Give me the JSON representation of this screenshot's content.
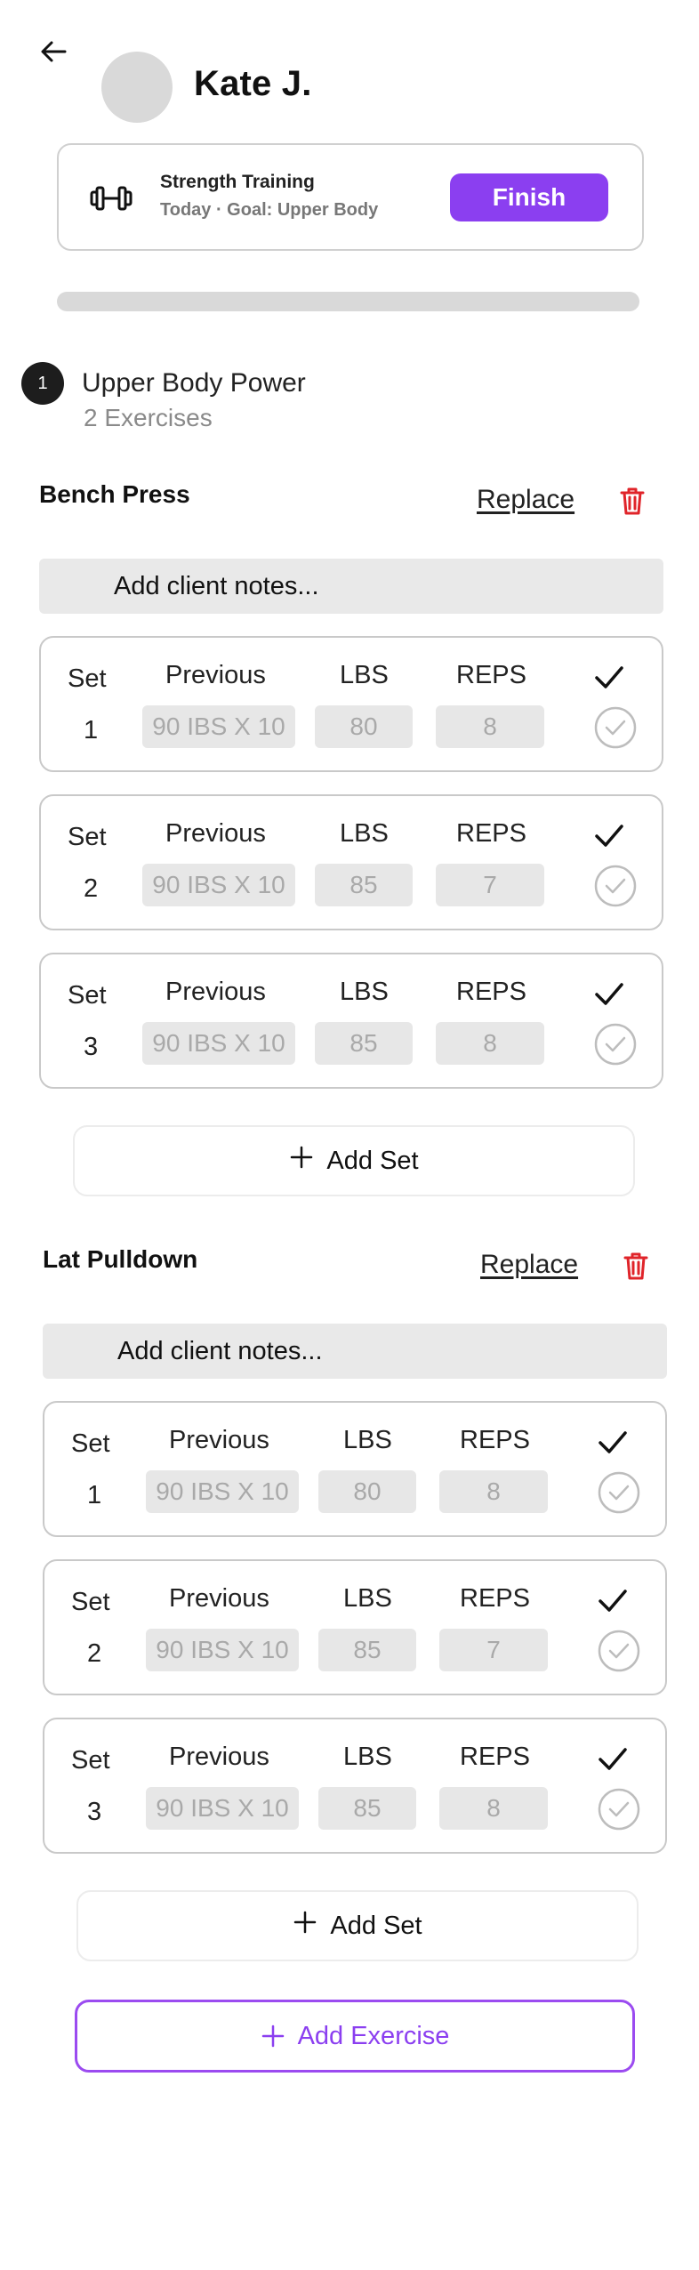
{
  "header": {
    "client_name": "Kate J."
  },
  "session": {
    "title": "Strength Training",
    "subtitle": "Today · Goal: Upper Body",
    "finish_label": "Finish",
    "progress": 0
  },
  "workout": {
    "number": "1",
    "title": "Upper Body Power",
    "subtitle": "2 Exercises"
  },
  "columns": {
    "set": "Set",
    "previous": "Previous",
    "lbs": "LBS",
    "reps": "REPS"
  },
  "actions": {
    "replace": "Replace",
    "notes_placeholder": "Add client notes...",
    "add_set": "Add Set",
    "add_exercise": "Add Exercise"
  },
  "exercises": [
    {
      "name": "Bench Press",
      "sets": [
        {
          "num": "1",
          "previous": "90 IBS X 10",
          "lbs": "80",
          "reps": "8"
        },
        {
          "num": "2",
          "previous": "90 IBS X 10",
          "lbs": "85",
          "reps": "7"
        },
        {
          "num": "3",
          "previous": "90 IBS X 10",
          "lbs": "85",
          "reps": "8"
        }
      ]
    },
    {
      "name": "Lat Pulldown",
      "sets": [
        {
          "num": "1",
          "previous": "90 IBS X 10",
          "lbs": "80",
          "reps": "8"
        },
        {
          "num": "2",
          "previous": "90 IBS X 10",
          "lbs": "85",
          "reps": "7"
        },
        {
          "num": "3",
          "previous": "90 IBS X 10",
          "lbs": "85",
          "reps": "8"
        }
      ]
    }
  ],
  "colors": {
    "accent": "#8b3ff0",
    "delete": "#e0242a",
    "field_bg": "#e7e7e7"
  }
}
